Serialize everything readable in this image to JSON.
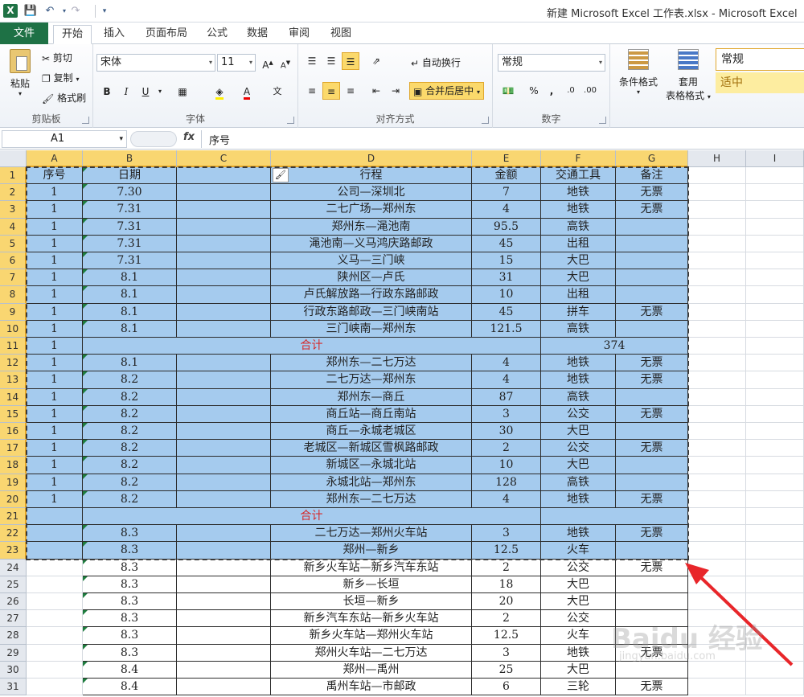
{
  "window": {
    "title": "新建 Microsoft Excel 工作表.xlsx - Microsoft Excel",
    "app_icon_letter": "X"
  },
  "ribbon_tabs": [
    "文件",
    "开始",
    "插入",
    "页面布局",
    "公式",
    "数据",
    "审阅",
    "视图"
  ],
  "ribbon": {
    "clipboard": {
      "paste": "粘贴",
      "cut": "剪切",
      "copy": "复制",
      "format_painter": "格式刷",
      "label": "剪贴板"
    },
    "font": {
      "name": "宋体",
      "size": "11",
      "bold": "B",
      "italic": "I",
      "underline": "U",
      "label": "字体"
    },
    "alignment": {
      "wrap_text": "自动换行",
      "merge_center": "合并后居中",
      "label": "对齐方式"
    },
    "number": {
      "format": "常规",
      "percent": "%",
      "comma": ",",
      "label": "数字"
    },
    "styles": {
      "conditional": "条件格式",
      "table_format_1": "套用",
      "table_format_2": "表格格式",
      "style_normal": "常规",
      "style_neutral": "适中"
    }
  },
  "formula_bar": {
    "name_box": "A1",
    "fx": "fx",
    "content": "序号"
  },
  "columns": [
    "A",
    "B",
    "C",
    "D",
    "E",
    "F",
    "G",
    "H",
    "I"
  ],
  "rows": [
    {
      "n": "1",
      "a": "序号",
      "b": "日期",
      "d": "行程",
      "e": "金额",
      "f": "交通工具",
      "g": "备注"
    },
    {
      "n": "2",
      "a": "1",
      "b": "7.30",
      "d": "公司—深圳北",
      "e": "7",
      "f": "地铁",
      "g": "无票"
    },
    {
      "n": "3",
      "a": "1",
      "b": "7.31",
      "d": "二七广场—郑州东",
      "e": "4",
      "f": "地铁",
      "g": "无票"
    },
    {
      "n": "4",
      "a": "1",
      "b": "7.31",
      "d": "郑州东—渑池南",
      "e": "95.5",
      "f": "高铁",
      "g": ""
    },
    {
      "n": "5",
      "a": "1",
      "b": "7.31",
      "d": "渑池南—义马鸿庆路邮政",
      "e": "45",
      "f": "出租",
      "g": ""
    },
    {
      "n": "6",
      "a": "1",
      "b": "7.31",
      "d": "义马—三门峡",
      "e": "15",
      "f": "大巴",
      "g": ""
    },
    {
      "n": "7",
      "a": "1",
      "b": "8.1",
      "d": "陕州区—卢氏",
      "e": "31",
      "f": "大巴",
      "g": ""
    },
    {
      "n": "8",
      "a": "1",
      "b": "8.1",
      "d": "卢氏解放路—行政东路邮政",
      "e": "10",
      "f": "出租",
      "g": ""
    },
    {
      "n": "9",
      "a": "1",
      "b": "8.1",
      "d": "行政东路邮政—三门峡南站",
      "e": "45",
      "f": "拼车",
      "g": "无票"
    },
    {
      "n": "10",
      "a": "1",
      "b": "8.1",
      "d": "三门峡南—郑州东",
      "e": "121.5",
      "f": "高铁",
      "g": ""
    },
    {
      "n": "11",
      "a": "1",
      "total_label": "合计",
      "f": "374",
      "total": true
    },
    {
      "n": "12",
      "a": "1",
      "b": "8.1",
      "d": "郑州东—二七万达",
      "e": "4",
      "f": "地铁",
      "g": "无票"
    },
    {
      "n": "13",
      "a": "1",
      "b": "8.2",
      "d": "二七万达—郑州东",
      "e": "4",
      "f": "地铁",
      "g": "无票"
    },
    {
      "n": "14",
      "a": "1",
      "b": "8.2",
      "d": "郑州东—商丘",
      "e": "87",
      "f": "高铁",
      "g": ""
    },
    {
      "n": "15",
      "a": "1",
      "b": "8.2",
      "d": "商丘站—商丘南站",
      "e": "3",
      "f": "公交",
      "g": "无票"
    },
    {
      "n": "16",
      "a": "1",
      "b": "8.2",
      "d": "商丘—永城老城区",
      "e": "30",
      "f": "大巴",
      "g": ""
    },
    {
      "n": "17",
      "a": "1",
      "b": "8.2",
      "d": "老城区—新城区雪枫路邮政",
      "e": "2",
      "f": "公交",
      "g": "无票"
    },
    {
      "n": "18",
      "a": "1",
      "b": "8.2",
      "d": "新城区—永城北站",
      "e": "10",
      "f": "大巴",
      "g": ""
    },
    {
      "n": "19",
      "a": "1",
      "b": "8.2",
      "d": "永城北站—郑州东",
      "e": "128",
      "f": "高铁",
      "g": ""
    },
    {
      "n": "20",
      "a": "1",
      "b": "8.2",
      "d": "郑州东—二七万达",
      "e": "4",
      "f": "地铁",
      "g": "无票"
    },
    {
      "n": "21",
      "a": "",
      "total_label": "合计",
      "f": "",
      "total": true
    },
    {
      "n": "22",
      "a": "",
      "b": "8.3",
      "d": "二七万达—郑州火车站",
      "e": "3",
      "f": "地铁",
      "g": "无票"
    },
    {
      "n": "23",
      "a": "",
      "b": "8.3",
      "d": "郑州—新乡",
      "e": "12.5",
      "f": "火车",
      "g": ""
    },
    {
      "n": "24",
      "a": "",
      "b": "8.3",
      "d": "新乡火车站—新乡汽车东站",
      "e": "2",
      "f": "公交",
      "g": "无票"
    },
    {
      "n": "25",
      "a": "",
      "b": "8.3",
      "d": "新乡—长垣",
      "e": "18",
      "f": "大巴",
      "g": ""
    },
    {
      "n": "26",
      "a": "",
      "b": "8.3",
      "d": "长垣—新乡",
      "e": "20",
      "f": "大巴",
      "g": ""
    },
    {
      "n": "27",
      "a": "",
      "b": "8.3",
      "d": "新乡汽车东站—新乡火车站",
      "e": "2",
      "f": "公交",
      "g": ""
    },
    {
      "n": "28",
      "a": "",
      "b": "8.3",
      "d": "新乡火车站—郑州火车站",
      "e": "12.5",
      "f": "火车",
      "g": ""
    },
    {
      "n": "29",
      "a": "",
      "b": "8.3",
      "d": "郑州火车站—二七万达",
      "e": "3",
      "f": "地铁",
      "g": "无票"
    },
    {
      "n": "30",
      "a": "",
      "b": "8.4",
      "d": "郑州—禹州",
      "e": "25",
      "f": "大巴",
      "g": ""
    },
    {
      "n": "31",
      "a": "",
      "b": "8.4",
      "d": "禹州车站—市邮政",
      "e": "6",
      "f": "三轮",
      "g": "无票"
    }
  ],
  "watermark": {
    "brand": "Baidu 经验",
    "sub": "jingyan.baidu.com"
  }
}
